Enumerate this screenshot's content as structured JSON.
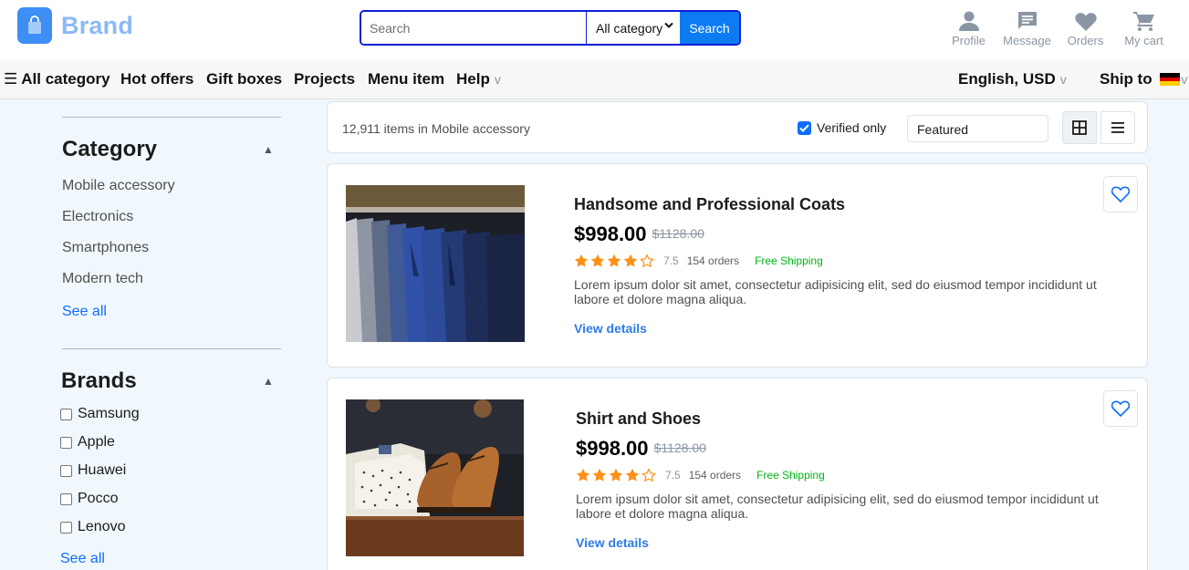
{
  "header": {
    "brand": "Brand",
    "search_placeholder": "Search",
    "search_category": "All category",
    "search_button": "Search",
    "actions": [
      {
        "label": "Profile",
        "icon": "person-icon"
      },
      {
        "label": "Message",
        "icon": "message-icon"
      },
      {
        "label": "Orders",
        "icon": "heart-icon"
      },
      {
        "label": "My cart",
        "icon": "cart-icon"
      }
    ]
  },
  "nav": {
    "all_category": "All category",
    "items": [
      "Hot offers",
      "Gift boxes",
      "Projects",
      "Menu item",
      "Help"
    ],
    "help_caret": "v",
    "language": "English, USD",
    "ship_to": "Ship to",
    "caret": "v"
  },
  "sidebar": {
    "category_title": "Category",
    "categories": [
      "Mobile accessory",
      "Electronics",
      "Smartphones",
      "Modern tech"
    ],
    "category_see_all": "See all",
    "brands_title": "Brands",
    "brands": [
      "Samsung",
      "Apple",
      "Huawei",
      "Pocco",
      "Lenovo"
    ],
    "brands_see_all": "See all",
    "caret_up": "▲"
  },
  "toolbar": {
    "count_text": "12,911 items in Mobile accessory",
    "verified_label": "Verified only",
    "verified_checked": true,
    "sort_value": "Featured"
  },
  "products": [
    {
      "title": "Handsome and Professional Coats",
      "price": "$998.00",
      "old_price": "$1128.00",
      "stars": 4,
      "rating": "7.5",
      "orders": "154 orders",
      "shipping": "Free Shipping",
      "description": "Lorem ipsum dolor sit amet, consectetur adipisicing elit, sed do eiusmod tempor incididunt ut labore et dolore magna aliqua.",
      "link": "View details"
    },
    {
      "title": "Shirt and Shoes",
      "price": "$998.00",
      "old_price": "$1128.00",
      "stars": 4,
      "rating": "7.5",
      "orders": "154 orders",
      "shipping": "Free Shipping",
      "description": "Lorem ipsum dolor sit amet, consectetur adipisicing elit, sed do eiusmod tempor incididunt ut labore et dolore magna aliqua.",
      "link": "View details"
    }
  ],
  "colors": {
    "accent": "#0d6efd",
    "star": "#ff9017",
    "shipping": "#00b517",
    "search_border": "#0d1ed6"
  }
}
